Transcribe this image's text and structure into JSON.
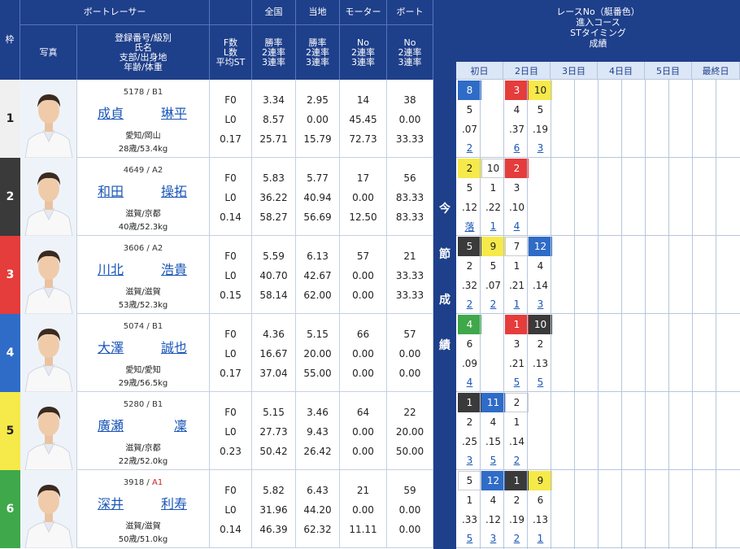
{
  "left_header": {
    "waku": "枠",
    "photo": "写真",
    "racer": "ボートレーサー",
    "info_lines": [
      "登録番号/級別",
      "氏名",
      "支部/出身地",
      "年齢/体重"
    ],
    "fl_lines": [
      "F数",
      "L数",
      "平均ST"
    ],
    "national": "全国",
    "local": "当地",
    "motor": "モーター",
    "boat": "ボート",
    "rate_lines": [
      "勝率",
      "2連率",
      "3連率"
    ],
    "mb_lines": [
      "No",
      "2連率",
      "3連率"
    ]
  },
  "mid_label": [
    "今",
    "節",
    "成",
    "績"
  ],
  "right_header": [
    "レースNo（艇番色）",
    "進入コース",
    "STタイミング",
    "成績"
  ],
  "days": [
    "初日",
    "2日目",
    "3日目",
    "4日目",
    "5日目",
    "最終日"
  ],
  "colors": {
    "b1": "#ffffff",
    "b2": "#3a3a3a",
    "b3": "#e53c3c",
    "b4": "#2f6cc7",
    "b5": "#f6e94a",
    "b6": "#3fa84a",
    "header": "#1e3f8a"
  },
  "racers": [
    {
      "waku": "1",
      "reg": "5178 / B1",
      "class": "B1",
      "sei": "成貞",
      "mei": "琳平",
      "branch": "愛知/岡山",
      "age": "28歳/53.4kg",
      "f": "F0",
      "l": "L0",
      "st": "0.17",
      "nat": [
        "3.34",
        "8.57",
        "25.71"
      ],
      "loc": [
        "2.95",
        "0.00",
        "15.79"
      ],
      "motor": [
        "14",
        "45.45",
        "72.73"
      ],
      "boat": [
        "38",
        "0.00",
        "33.33"
      ],
      "races": [
        {
          "col": 0,
          "no": "8",
          "b": 4,
          "course": "5",
          "st": ".07",
          "res": "2"
        },
        {
          "col": 2,
          "no": "3",
          "b": 3,
          "course": "4",
          "st": ".37",
          "res": "6"
        },
        {
          "col": 3,
          "no": "10",
          "b": 5,
          "course": "5",
          "st": ".19",
          "res": "3"
        }
      ]
    },
    {
      "waku": "2",
      "reg": "4649 / A2",
      "class": "A2",
      "sei": "和田",
      "mei": "操拓",
      "branch": "滋賀/京都",
      "age": "40歳/52.3kg",
      "f": "F0",
      "l": "L0",
      "st": "0.14",
      "nat": [
        "5.83",
        "36.22",
        "58.27"
      ],
      "loc": [
        "5.77",
        "40.94",
        "56.69"
      ],
      "motor": [
        "17",
        "0.00",
        "12.50"
      ],
      "boat": [
        "56",
        "83.33",
        "83.33"
      ],
      "races": [
        {
          "col": 0,
          "no": "2",
          "b": 5,
          "course": "5",
          "st": ".12",
          "res": "落"
        },
        {
          "col": 1,
          "no": "10",
          "b": 1,
          "course": "1",
          "st": ".22",
          "res": "1"
        },
        {
          "col": 2,
          "no": "2",
          "b": 3,
          "course": "3",
          "st": ".10",
          "res": "4"
        }
      ]
    },
    {
      "waku": "3",
      "reg": "3606 / A2",
      "class": "A2",
      "sei": "川北",
      "mei": "浩貴",
      "branch": "滋賀/滋賀",
      "age": "53歳/52.3kg",
      "f": "F0",
      "l": "L0",
      "st": "0.15",
      "nat": [
        "5.59",
        "40.70",
        "58.14"
      ],
      "loc": [
        "6.13",
        "42.67",
        "62.00"
      ],
      "motor": [
        "57",
        "0.00",
        "0.00"
      ],
      "boat": [
        "21",
        "33.33",
        "33.33"
      ],
      "races": [
        {
          "col": 0,
          "no": "5",
          "b": 2,
          "course": "2",
          "st": ".32",
          "res": "2"
        },
        {
          "col": 1,
          "no": "9",
          "b": 5,
          "course": "5",
          "st": ".07",
          "res": "2"
        },
        {
          "col": 2,
          "no": "7",
          "b": 1,
          "course": "1",
          "st": ".21",
          "res": "1"
        },
        {
          "col": 3,
          "no": "12",
          "b": 4,
          "course": "4",
          "st": ".14",
          "res": "3"
        }
      ]
    },
    {
      "waku": "4",
      "reg": "5074 / B1",
      "class": "B1",
      "sei": "大澤",
      "mei": "誠也",
      "branch": "愛知/愛知",
      "age": "29歳/56.5kg",
      "f": "F0",
      "l": "L0",
      "st": "0.17",
      "nat": [
        "4.36",
        "16.67",
        "37.04"
      ],
      "loc": [
        "5.15",
        "20.00",
        "55.00"
      ],
      "motor": [
        "66",
        "0.00",
        "0.00"
      ],
      "boat": [
        "57",
        "0.00",
        "0.00"
      ],
      "races": [
        {
          "col": 0,
          "no": "4",
          "b": 6,
          "course": "6",
          "st": ".09",
          "res": "4"
        },
        {
          "col": 2,
          "no": "1",
          "b": 3,
          "course": "3",
          "st": ".21",
          "res": "5"
        },
        {
          "col": 3,
          "no": "10",
          "b": 2,
          "course": "2",
          "st": ".13",
          "res": "5"
        }
      ]
    },
    {
      "waku": "5",
      "reg": "5280 / B1",
      "class": "B1",
      "sei": "廣瀬",
      "mei": "凜",
      "branch": "滋賀/京都",
      "age": "22歳/52.0kg",
      "f": "F0",
      "l": "L0",
      "st": "0.23",
      "nat": [
        "5.15",
        "27.73",
        "50.42"
      ],
      "loc": [
        "3.46",
        "9.43",
        "26.42"
      ],
      "motor": [
        "64",
        "0.00",
        "0.00"
      ],
      "boat": [
        "22",
        "20.00",
        "50.00"
      ],
      "races": [
        {
          "col": 0,
          "no": "1",
          "b": 2,
          "course": "2",
          "st": ".25",
          "res": "3"
        },
        {
          "col": 1,
          "no": "11",
          "b": 4,
          "course": "4",
          "st": ".15",
          "res": "5"
        },
        {
          "col": 2,
          "no": "2",
          "b": 1,
          "course": "1",
          "st": ".14",
          "res": "2"
        }
      ]
    },
    {
      "waku": "6",
      "reg": "3918 / A1",
      "class": "A1",
      "sei": "深井",
      "mei": "利寿",
      "branch": "滋賀/滋賀",
      "age": "50歳/51.0kg",
      "f": "F0",
      "l": "L0",
      "st": "0.14",
      "nat": [
        "5.82",
        "31.96",
        "46.39"
      ],
      "loc": [
        "6.43",
        "44.20",
        "62.32"
      ],
      "motor": [
        "21",
        "0.00",
        "11.11"
      ],
      "boat": [
        "59",
        "0.00",
        "0.00"
      ],
      "races": [
        {
          "col": 0,
          "no": "5",
          "b": 1,
          "course": "1",
          "st": ".33",
          "res": "5"
        },
        {
          "col": 1,
          "no": "12",
          "b": 4,
          "course": "4",
          "st": ".12",
          "res": "3"
        },
        {
          "col": 2,
          "no": "1",
          "b": 2,
          "course": "2",
          "st": ".19",
          "res": "2"
        },
        {
          "col": 3,
          "no": "9",
          "b": 5,
          "course": "6",
          "st": ".13",
          "res": "1"
        }
      ]
    }
  ]
}
